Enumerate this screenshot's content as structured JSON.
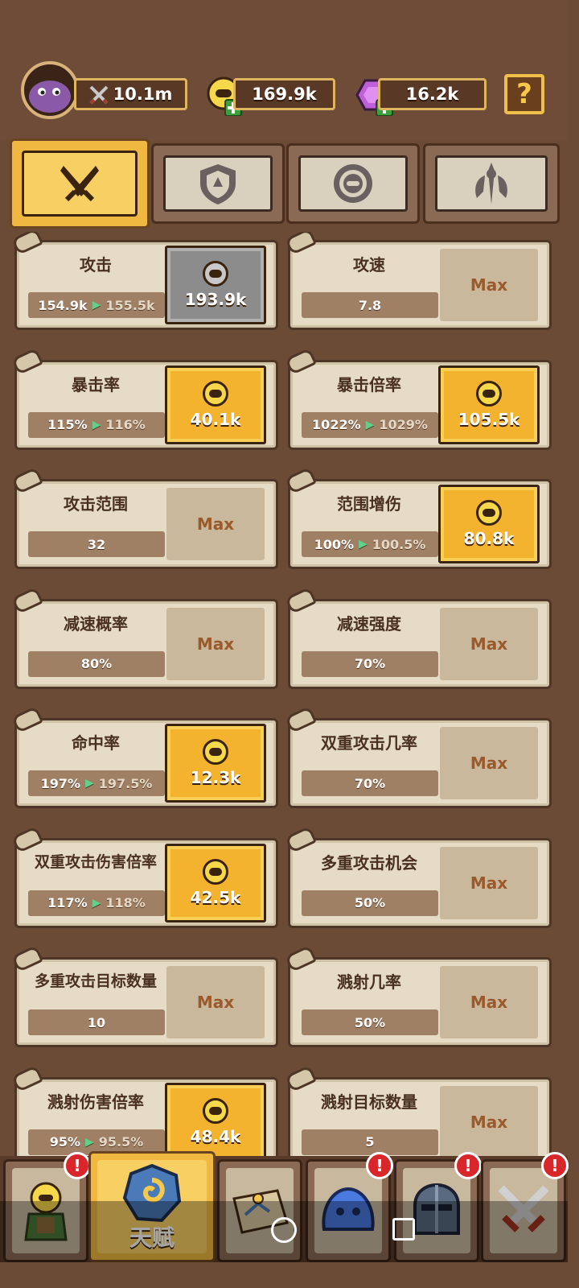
{
  "resources": {
    "power": "10.1m",
    "gold": "169.9k",
    "gems": "16.2k",
    "help": "?"
  },
  "tabs": [
    {
      "icon": "crossed-swords-icon",
      "active": true
    },
    {
      "icon": "shield-icon",
      "active": false
    },
    {
      "icon": "ring-icon",
      "active": false
    },
    {
      "icon": "tower-icon",
      "active": false
    }
  ],
  "cards": [
    {
      "title": "攻击",
      "current": "154.9k",
      "next": "155.5k",
      "button": "193.9k",
      "state": "locked"
    },
    {
      "title": "攻速",
      "current": "7.8",
      "next": null,
      "button": "Max",
      "state": "max"
    },
    {
      "title": "暴击率",
      "current": "115%",
      "next": "116%",
      "button": "40.1k",
      "state": "buy"
    },
    {
      "title": "暴击倍率",
      "current": "1022%",
      "next": "1029%",
      "button": "105.5k",
      "state": "buy"
    },
    {
      "title": "攻击范围",
      "current": "32",
      "next": null,
      "button": "Max",
      "state": "max"
    },
    {
      "title": "范围增伤",
      "current": "100%",
      "next": "100.5%",
      "button": "80.8k",
      "state": "buy"
    },
    {
      "title": "减速概率",
      "current": "80%",
      "next": null,
      "button": "Max",
      "state": "max"
    },
    {
      "title": "减速强度",
      "current": "70%",
      "next": null,
      "button": "Max",
      "state": "max"
    },
    {
      "title": "命中率",
      "current": "197%",
      "next": "197.5%",
      "button": "12.3k",
      "state": "buy"
    },
    {
      "title": "双重攻击几率",
      "current": "70%",
      "next": null,
      "button": "Max",
      "state": "max"
    },
    {
      "title": "双重攻击伤害倍率",
      "current": "117%",
      "next": "118%",
      "button": "42.5k",
      "state": "buy"
    },
    {
      "title": "多重攻击机会",
      "current": "50%",
      "next": null,
      "button": "Max",
      "state": "max"
    },
    {
      "title": "多重攻击目标数量",
      "current": "10",
      "next": null,
      "button": "Max",
      "state": "max"
    },
    {
      "title": "溅射几率",
      "current": "50%",
      "next": null,
      "button": "Max",
      "state": "max"
    },
    {
      "title": "溅射伤害倍率",
      "current": "95%",
      "next": "95.5%",
      "button": "48.4k",
      "state": "buy"
    },
    {
      "title": "溅射目标数量",
      "current": "5",
      "next": null,
      "button": "Max",
      "state": "max"
    }
  ],
  "nav": [
    {
      "icon": "hero-icon",
      "badge": "!",
      "active": false
    },
    {
      "icon": "rune-icon",
      "label": "天赋",
      "active": true
    },
    {
      "icon": "scroll-map-icon",
      "badge": null,
      "active": false
    },
    {
      "icon": "slime-icon",
      "badge": "!",
      "active": false
    },
    {
      "icon": "helmet-icon",
      "badge": "!",
      "active": false
    },
    {
      "icon": "battle-swords-icon",
      "badge": "!",
      "active": false
    }
  ],
  "colors": {
    "background": "#6b4a36",
    "accent_gold": "#f3b32e",
    "card": "#e6dcc6",
    "badge": "#d8262a"
  }
}
